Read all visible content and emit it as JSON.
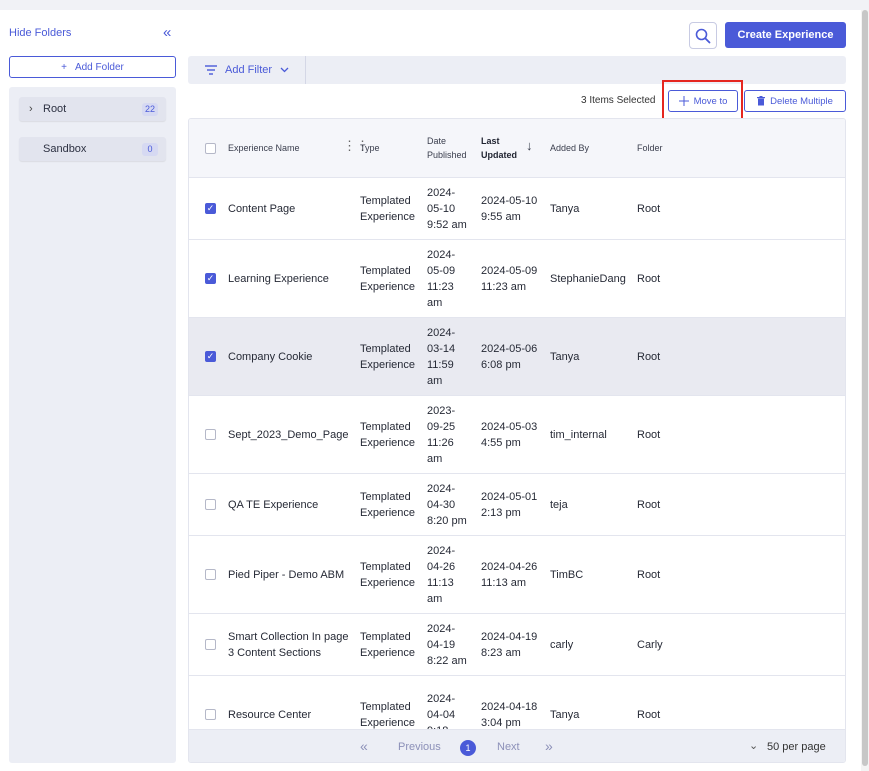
{
  "folders_panel": {
    "hide_label": "Hide Folders",
    "collapse_icon": "double-chevron-left-icon",
    "add_folder_label": "Add Folder",
    "items": [
      {
        "label": "Root",
        "count": "22"
      },
      {
        "label": "Sandbox",
        "count": "0"
      }
    ]
  },
  "header": {
    "create_label": "Create Experience",
    "filter_label": "Add Filter"
  },
  "selection": {
    "selected_text": "3 Items Selected",
    "move_label": "Move to",
    "delete_label": "Delete Multiple"
  },
  "table": {
    "columns": {
      "name": "Experience Name",
      "type": "Type",
      "date_published": "Date Published",
      "last_updated": "Last Updated",
      "added_by": "Added By",
      "folder": "Folder"
    },
    "rows": [
      {
        "checked": true,
        "name": "Content Page",
        "type": "Templated Experience",
        "published": [
          "2024-",
          "05-10",
          "9:52 am"
        ],
        "updated": [
          "2024-05-10",
          "9:55 am"
        ],
        "added_by": "Tanya",
        "folder": "Root"
      },
      {
        "checked": true,
        "name": "Learning Experience",
        "type": "Templated Experience",
        "published": [
          "2024-",
          "05-09",
          "11:23",
          "am"
        ],
        "updated": [
          "2024-05-09",
          "11:23 am"
        ],
        "added_by": "StephanieDang",
        "folder": "Root"
      },
      {
        "checked": true,
        "name": "Company Cookie",
        "type": "Templated Experience",
        "published": [
          "2024-",
          "03-14",
          "11:59",
          "am"
        ],
        "updated": [
          "2024-05-06",
          "6:08 pm"
        ],
        "added_by": "Tanya",
        "folder": "Root"
      },
      {
        "checked": false,
        "name": "Sept_2023_Demo_Page",
        "type": "Templated Experience",
        "published": [
          "2023-",
          "09-25",
          "11:26",
          "am"
        ],
        "updated": [
          "2024-05-03",
          "4:55 pm"
        ],
        "added_by": "tim_internal",
        "folder": "Root"
      },
      {
        "checked": false,
        "name": "QA TE Experience",
        "type": "Templated Experience",
        "published": [
          "2024-",
          "04-30",
          "8:20 pm"
        ],
        "updated": [
          "2024-05-01",
          "2:13 pm"
        ],
        "added_by": "teja",
        "folder": "Root"
      },
      {
        "checked": false,
        "name": "Pied Piper - Demo ABM",
        "type": "Templated Experience",
        "published": [
          "2024-",
          "04-26",
          "11:13",
          "am"
        ],
        "updated": [
          "2024-04-26",
          "11:13 am"
        ],
        "added_by": "TimBC",
        "folder": "Root"
      },
      {
        "checked": false,
        "name": "Smart Collection In page 3 Content Sections",
        "type": "Templated Experience",
        "published": [
          "2024-",
          "04-19",
          "8:22 am"
        ],
        "updated": [
          "2024-04-19",
          "8:23 am"
        ],
        "added_by": "carly",
        "folder": "Carly"
      },
      {
        "checked": false,
        "name": "Resource Center",
        "type": "Templated Experience",
        "published": [
          "2024-",
          "04-04",
          "9:18"
        ],
        "updated": [
          "2024-04-18",
          "3:04 pm"
        ],
        "added_by": "Tanya",
        "folder": "Root"
      }
    ]
  },
  "pagination": {
    "prev_label": "Previous",
    "next_label": "Next",
    "current_page": "1",
    "per_page_label": "50 per page"
  },
  "colors": {
    "accent": "#4a5ad8",
    "highlight_border": "#e5261f"
  }
}
